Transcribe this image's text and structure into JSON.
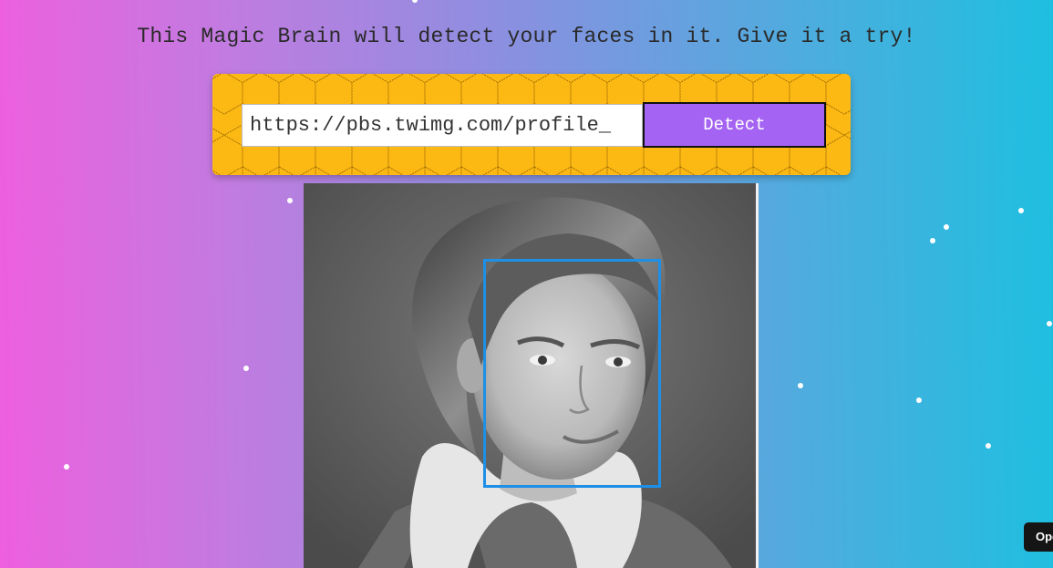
{
  "tagline": "This Magic Brain will detect your faces in it. Give it a try!",
  "form": {
    "url_value": "https://pbs.twimg.com/profile_",
    "detect_label": "Detect"
  },
  "result": {
    "faces_detected": 1,
    "face_box_color": "#1e8fe6"
  },
  "corner_widget": {
    "label": "Ope"
  },
  "colors": {
    "gradient_left": "#ee5fdf",
    "gradient_right": "#1ebfe0",
    "panel_yellow": "#fdb913",
    "button_purple": "#a463f2"
  },
  "icons": [
    "honeycomb-pattern"
  ]
}
